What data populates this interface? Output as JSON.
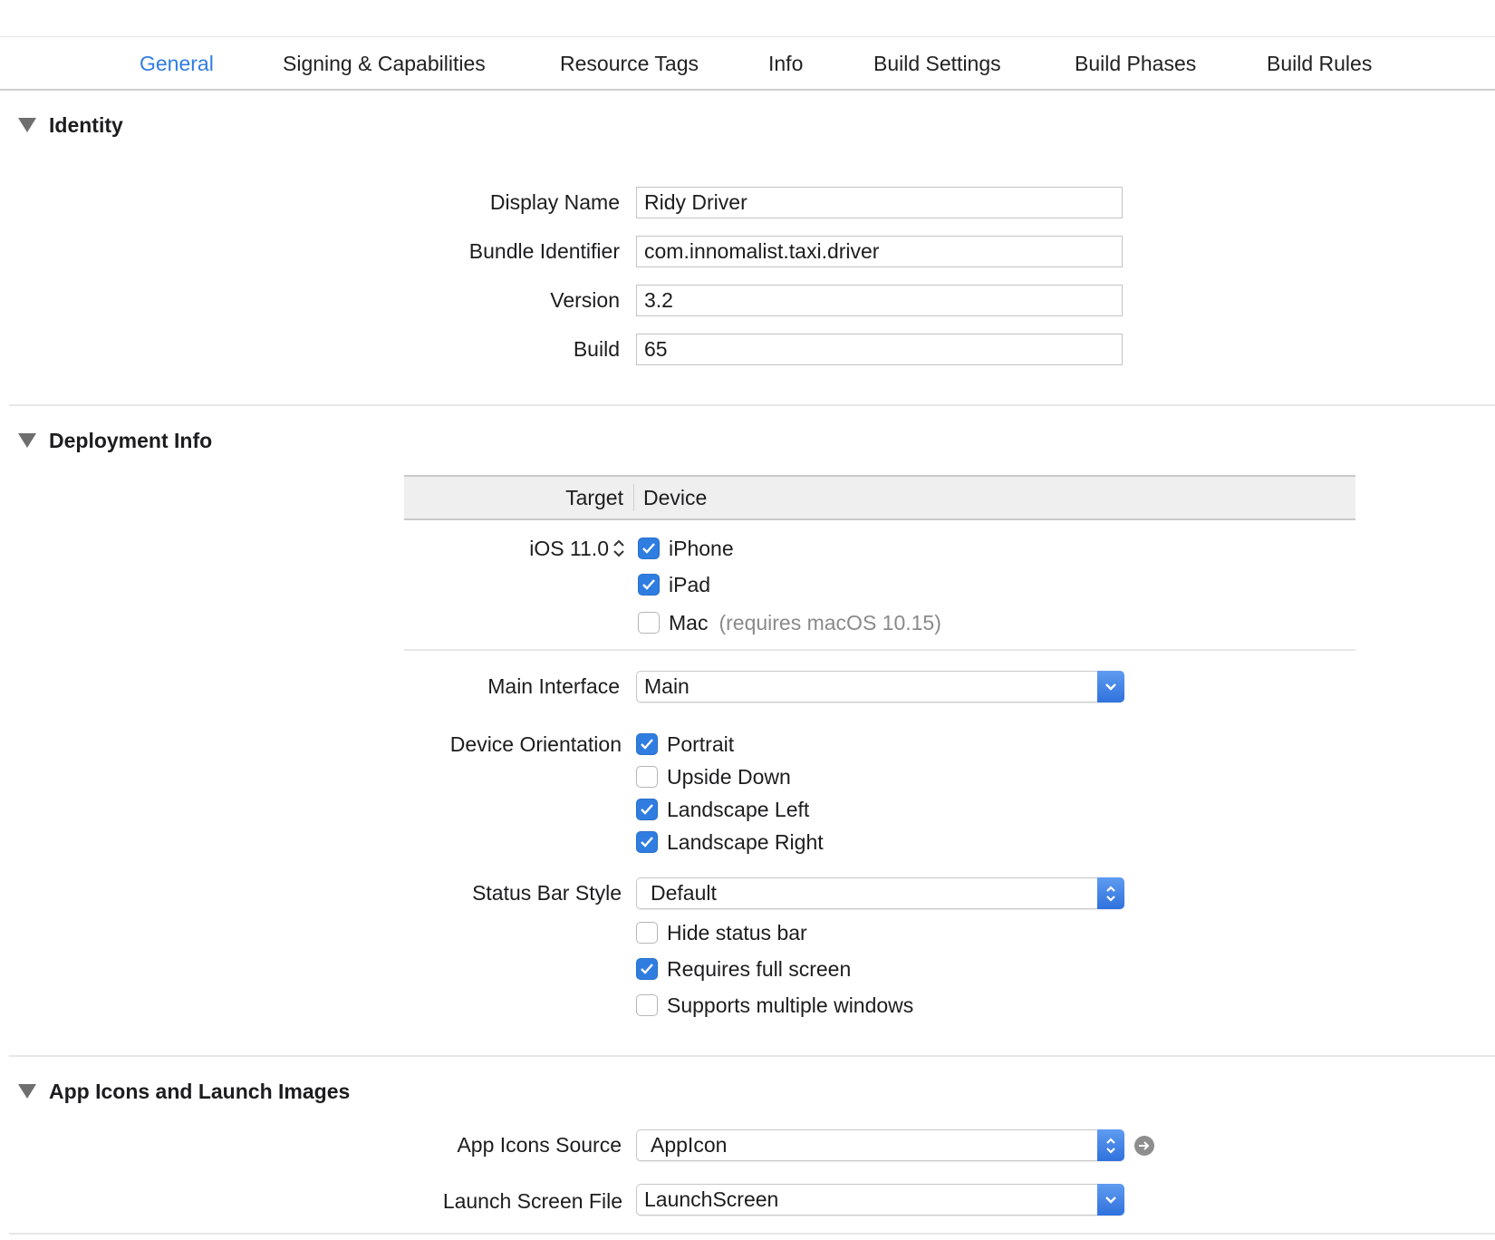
{
  "tabs": [
    {
      "label": "General",
      "active": true
    },
    {
      "label": "Signing & Capabilities"
    },
    {
      "label": "Resource Tags"
    },
    {
      "label": "Info"
    },
    {
      "label": "Build Settings"
    },
    {
      "label": "Build Phases"
    },
    {
      "label": "Build Rules"
    }
  ],
  "identity": {
    "title": "Identity",
    "display_name_label": "Display Name",
    "display_name_value": "Ridy Driver",
    "bundle_id_label": "Bundle Identifier",
    "bundle_id_value": "com.innomalist.taxi.driver",
    "version_label": "Version",
    "version_value": "3.2",
    "build_label": "Build",
    "build_value": "65"
  },
  "deployment": {
    "title": "Deployment Info",
    "col_target": "Target",
    "col_device": "Device",
    "target_value": "iOS 11.0",
    "devices": [
      {
        "label": "iPhone",
        "checked": true
      },
      {
        "label": "iPad",
        "checked": true
      },
      {
        "label": "Mac",
        "checked": false,
        "hint": "(requires macOS 10.15)"
      }
    ],
    "main_interface_label": "Main Interface",
    "main_interface_value": "Main",
    "orientation_label": "Device Orientation",
    "orientations": [
      {
        "label": "Portrait",
        "checked": true
      },
      {
        "label": "Upside Down",
        "checked": false
      },
      {
        "label": "Landscape Left",
        "checked": true
      },
      {
        "label": "Landscape Right",
        "checked": true
      }
    ],
    "status_bar_label": "Status Bar Style",
    "status_bar_value": "Default",
    "status_options": [
      {
        "label": "Hide status bar",
        "checked": false
      },
      {
        "label": "Requires full screen",
        "checked": true
      },
      {
        "label": "Supports multiple windows",
        "checked": false
      }
    ]
  },
  "app_icons": {
    "title": "App Icons and Launch Images",
    "icons_source_label": "App Icons Source",
    "icons_source_value": "AppIcon",
    "launch_screen_label": "Launch Screen File",
    "launch_screen_value": "LaunchScreen"
  },
  "colors": {
    "accent": "#2f7de1",
    "checkbox_on": "#2f7de1",
    "disclosure": "#6e6e6e",
    "hint_text": "#8a8a8a"
  },
  "icons": {
    "disclosure": "disclosure-triangle-down-icon",
    "checkmark": "checkmark-icon",
    "stepper": "up-down-chevron-icon",
    "dropdown": "chevron-down-icon",
    "popup_updown": "up-down-arrows-icon",
    "go_arrow": "arrow-right-circle-icon"
  }
}
